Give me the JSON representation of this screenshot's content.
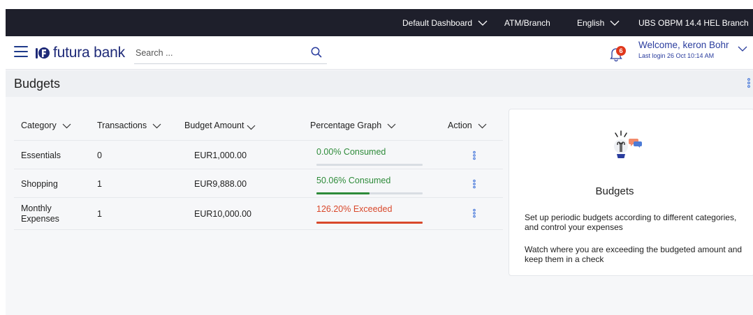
{
  "topbar": {
    "default_dashboard": "Default Dashboard",
    "atm_branch": "ATM/Branch",
    "language": "English",
    "branch": "UBS OBPM 14.4 HEL Branch"
  },
  "header": {
    "brand": "futura bank",
    "search_placeholder": "Search ...",
    "notifications_count": "6",
    "welcome": "Welcome, keron Bohr",
    "last_login": "Last login 26 Oct 10:14 AM"
  },
  "page": {
    "title": "Budgets"
  },
  "table": {
    "columns": {
      "category": "Category",
      "transactions": "Transactions",
      "budget_amount": "Budget Amount",
      "percentage_graph": "Percentage Graph",
      "action": "Action"
    },
    "rows": [
      {
        "category": "Essentials",
        "transactions": "0",
        "amount": "EUR1,000.00",
        "percentage_text": "0.00% Consumed",
        "fraction": 0.0,
        "status": "consumed"
      },
      {
        "category": "Shopping",
        "transactions": "1",
        "amount": "EUR9,888.00",
        "percentage_text": "50.06% Consumed",
        "fraction": 0.5006,
        "status": "consumed"
      },
      {
        "category": "Monthly Expenses",
        "transactions": "1",
        "amount": "EUR10,000.00",
        "percentage_text": "126.20% Exceeded",
        "fraction": 1.0,
        "status": "exceeded"
      }
    ]
  },
  "info_card": {
    "title": "Budgets",
    "para1": "Set up periodic budgets according to different categories, and control your expenses",
    "para2": "Watch where you are exceeding the budgeted amount and keep them in a check"
  },
  "colors": {
    "topbar_bg": "#1e1f2b",
    "brand_blue": "#1e2a78",
    "consumed_green": "#2e8b3a",
    "exceeded_red": "#d9482b",
    "badge_red": "#e0381c",
    "kebab_blue": "#3b6fd8"
  },
  "icons": {
    "menu": "hamburger-icon",
    "search": "search-icon",
    "notifications": "bell-icon",
    "chevron": "chevron-down-icon",
    "more": "kebab-icon",
    "illustration": "lightbulb-chat-icon"
  }
}
